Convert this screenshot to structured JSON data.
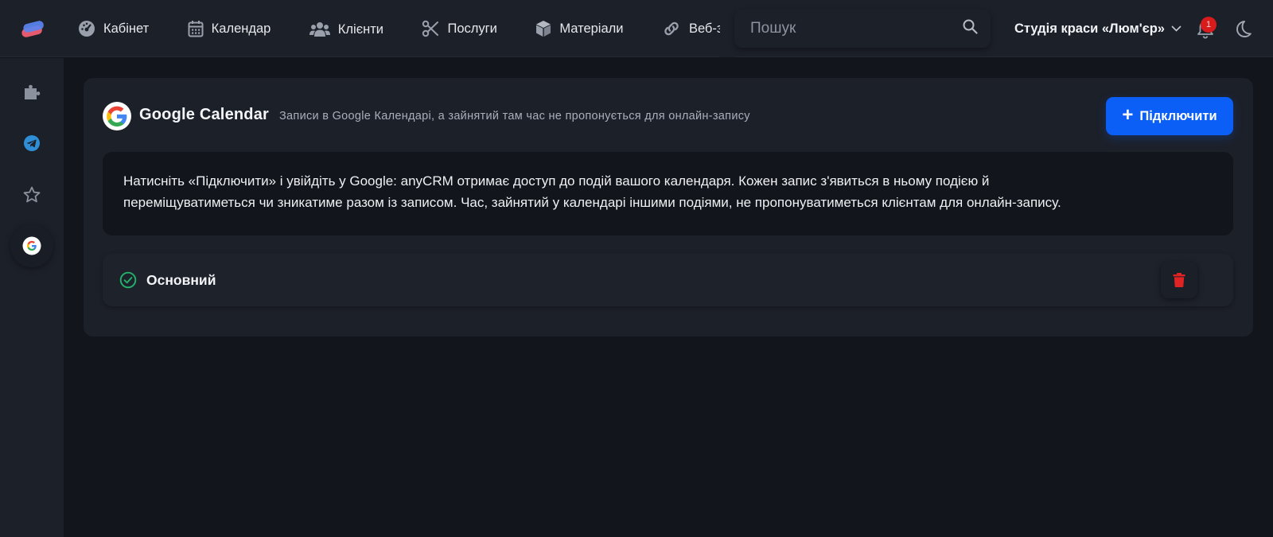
{
  "header": {
    "nav": [
      {
        "label": "Кабінет",
        "icon": "dashboard-icon"
      },
      {
        "label": "Календар",
        "icon": "calendar-icon"
      },
      {
        "label": "Клієнти",
        "icon": "users-icon"
      },
      {
        "label": "Послуги",
        "icon": "scissors-icon"
      },
      {
        "label": "Матеріали",
        "icon": "box-icon"
      },
      {
        "label": "Веб-заст",
        "icon": "link-icon"
      }
    ],
    "search_placeholder": "Пошук",
    "studio_name": "Студія краси «Люм'єр»",
    "notifications_count": "1"
  },
  "sidebar": {
    "items": [
      {
        "icon": "puzzle-icon"
      },
      {
        "icon": "telegram-icon"
      },
      {
        "icon": "star-icon"
      },
      {
        "icon": "google-icon",
        "active": true
      }
    ]
  },
  "integration": {
    "title": "Google Calendar",
    "subtitle": "Записи в Google Календарі, а зайнятий там час не пропонується для онлайн-запису",
    "connect_label": "Підключити",
    "info_line1": "Натисніть «Підключити» і увійдіть у Google: anyCRM отримає доступ до подій вашого календаря. Кожен запис з'явиться в ньому подією й",
    "info_line2": "переміщуватиметься чи зникатиме разом із записом. Час, зайнятий у календарі іншими подіями, не пропонуватиметься клієнтам для онлайн-запису.",
    "calendars": [
      {
        "name": "Основний",
        "status": "connected"
      }
    ]
  },
  "colors": {
    "accent": "#0b5ef6",
    "success": "#22b36b",
    "danger": "#e02424",
    "background": "#12151b",
    "surface": "#1c2029"
  }
}
